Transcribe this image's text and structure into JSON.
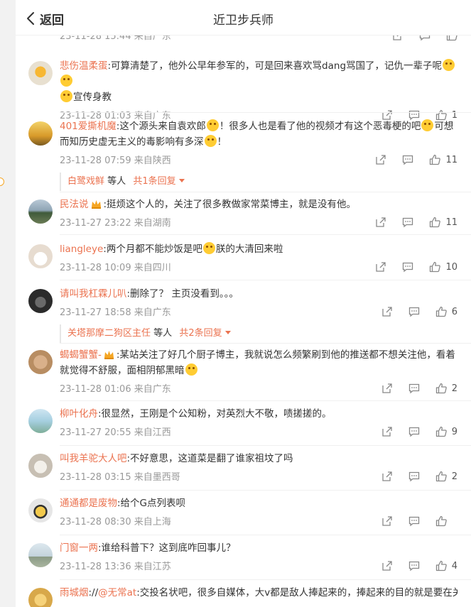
{
  "header": {
    "back_label": "返回",
    "title": "近卫步兵师"
  },
  "top_partial": {
    "meta": "23-11-28 15:44 来自广东"
  },
  "comments": [
    {
      "user": "悲伤温柔蛋",
      "text": ":可算清楚了，他外公早年参军的，可是回来喜欢骂dang骂国了，记仇一辈子呢",
      "text2": "宣传身教",
      "meta": "23-11-28 01:03 来自广东",
      "likes": "1"
    },
    {
      "user": "401爱撕机魔",
      "text": ":这个源头来自袁欢郎",
      "text2": "！很多人也是看了他的视频才有这个恶毒梗的吧",
      "text3": "可想而知历史虚无主义的毒影响有多深",
      "text4": "！",
      "meta": "23-11-28 07:59 来自陕西",
      "likes": "11",
      "reply_user": "白鹭戏鲜",
      "reply_mid": "等人",
      "reply_more": "共1条回复"
    },
    {
      "user": "民法说",
      "text": ":挺烦这个人的，关注了很多教做家常菜博主，就是没有他。",
      "meta": "23-11-27 23:22 来自湖南",
      "likes": "11"
    },
    {
      "user": "liangleye",
      "text": ":两个月都不能炒饭是吧",
      "text2": "朕的大清回来啦",
      "meta": "23-11-28 10:09 来自四川",
      "likes": "10"
    },
    {
      "user": "请叫我杠霖儿叭",
      "text": ":删除了？ 主页没看到。。。",
      "meta": "23-11-27 18:58 来自广东",
      "likes": "6",
      "reply_user": "关塔那摩二狗区主任",
      "reply_mid": "等人",
      "reply_more": "共2条回复"
    },
    {
      "user": "蝎蝎蟹蟹-",
      "text": ":某站关注了好几个厨子博主，我就说怎么频繁刷到他的推送都不想关注他，看着就觉得不舒服，面相阴郁黑暗",
      "meta": "23-11-28 01:06 来自广东",
      "likes": "2"
    },
    {
      "user": "柳叶化舟",
      "text": ":很显然，王刚是个公知粉，对英烈大不敬，啧搓搓的。",
      "meta": "23-11-27 20:55 来自江西",
      "likes": "9"
    },
    {
      "user": "叫我羊驼大人吧",
      "text": ":不好意思，这道菜是翻了谁家祖坟了吗",
      "meta": "23-11-28 03:15 来自墨西哥",
      "likes": "2"
    },
    {
      "user": "通通都是废物",
      "text": ":给个G点列表呗",
      "meta": "23-11-28 08:30 来自上海",
      "likes": ""
    },
    {
      "user": "门窗一两",
      "text": ":谁给科普下？这到底咋回事儿？",
      "meta": "23-11-28 13:36 来自江苏",
      "likes": "4"
    },
    {
      "user": "雨城烟",
      "text": "://",
      "mention": "@无常at",
      "text2": ":交投名状吧，很多自媒体，大v都是敌人捧起来的，捧起来的目的就是要在关",
      "meta": "",
      "likes": ""
    }
  ],
  "colors": {
    "accent": "#eb7350",
    "meta": "#999999",
    "text": "#333333",
    "divider": "#f0f0f0"
  },
  "icons": {
    "back": "chevron-left-icon",
    "share": "share-icon",
    "comment": "comment-icon",
    "like": "thumbs-up-icon"
  }
}
